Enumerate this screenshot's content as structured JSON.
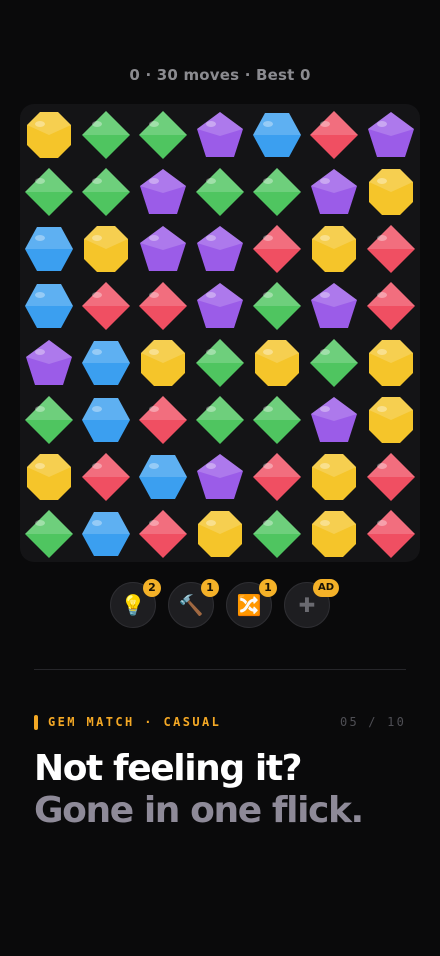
{
  "status": {
    "score": "0",
    "moves": "30 moves",
    "best": "Best 0",
    "text": "0 · 30 moves · Best 0"
  },
  "board": {
    "rows": [
      [
        "yellow",
        "green",
        "green",
        "purple",
        "blue",
        "red",
        "purple"
      ],
      [
        "green",
        "green",
        "purple",
        "green",
        "green",
        "purple",
        "yellow"
      ],
      [
        "blue",
        "yellow",
        "purple",
        "purple",
        "red",
        "yellow",
        "red"
      ],
      [
        "blue",
        "red",
        "red",
        "purple",
        "green",
        "purple",
        "red"
      ],
      [
        "purple",
        "blue",
        "yellow",
        "green",
        "yellow",
        "green",
        "yellow"
      ],
      [
        "green",
        "blue",
        "red",
        "green",
        "green",
        "purple",
        "yellow"
      ],
      [
        "yellow",
        "red",
        "blue",
        "purple",
        "red",
        "yellow",
        "red"
      ],
      [
        "green",
        "blue",
        "red",
        "yellow",
        "green",
        "yellow",
        "red"
      ]
    ],
    "gem_colors": {
      "yellow": "#f5c52a",
      "green": "#4fc560",
      "purple": "#9b5ce8",
      "blue": "#3b9ff0",
      "red": "#f04f62"
    }
  },
  "tools": [
    {
      "name": "hint",
      "icon": "lightbulb-icon",
      "glyph": "💡",
      "badge": "2"
    },
    {
      "name": "hammer",
      "icon": "hammer-icon",
      "glyph": "🔨",
      "badge": "1"
    },
    {
      "name": "shuffle",
      "icon": "shuffle-icon",
      "glyph": "🔀",
      "badge": "1"
    },
    {
      "name": "add",
      "icon": "plus-icon",
      "glyph": "✚",
      "badge": "AD"
    }
  ],
  "footer": {
    "category": "GEM MATCH · CASUAL",
    "counter": "05 / 10",
    "headline_1": "Not feeling it?",
    "headline_2": "Gone in one flick."
  },
  "accent": "#f4a825"
}
